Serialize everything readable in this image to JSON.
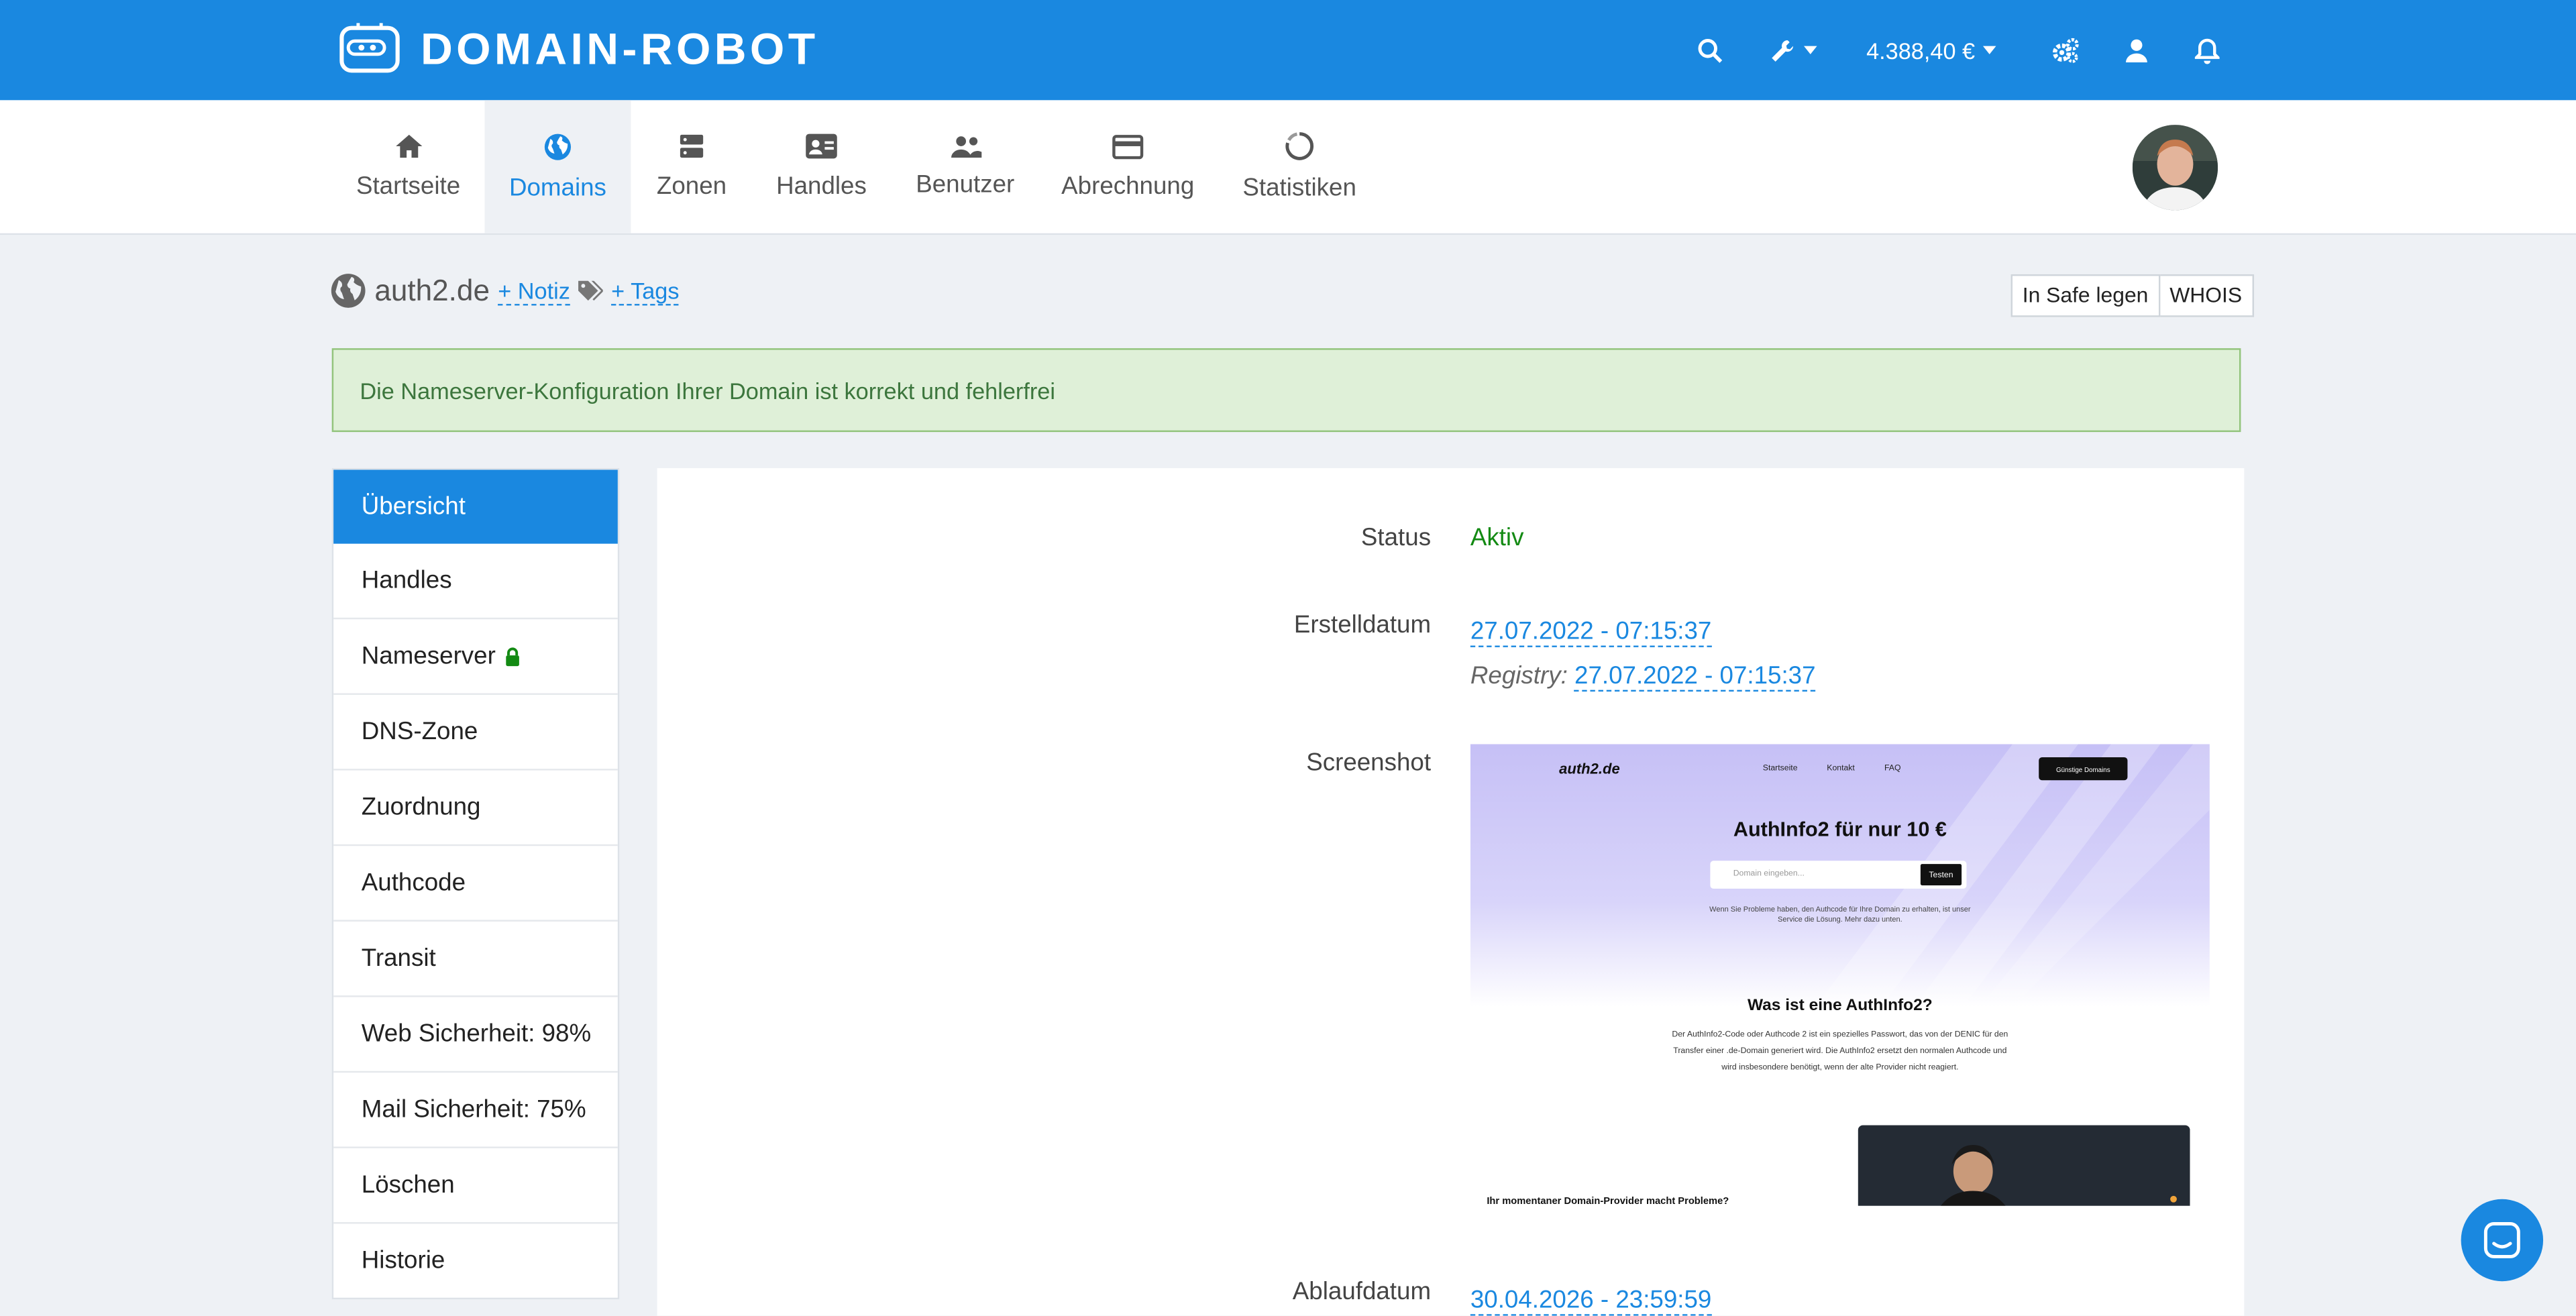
{
  "brand": {
    "name": "DOMAIN-ROBOT"
  },
  "topbar": {
    "balance": "4.388,40 €"
  },
  "nav": [
    {
      "label": "Startseite"
    },
    {
      "label": "Domains"
    },
    {
      "label": "Zonen"
    },
    {
      "label": "Handles"
    },
    {
      "label": "Benutzer"
    },
    {
      "label": "Abrechnung"
    },
    {
      "label": "Statistiken"
    }
  ],
  "domain": {
    "name": "auth2.de",
    "note_link": "+ Notiz",
    "tags_link": "+ Tags",
    "safe_button": "In Safe legen",
    "whois_button": "WHOIS"
  },
  "alert": {
    "text": "Die Nameserver-Konfiguration Ihrer Domain ist korrekt und fehlerfrei"
  },
  "sidebar": [
    {
      "label": "Übersicht"
    },
    {
      "label": "Handles"
    },
    {
      "label": "Nameserver"
    },
    {
      "label": "DNS-Zone"
    },
    {
      "label": "Zuordnung"
    },
    {
      "label": "Authcode"
    },
    {
      "label": "Transit"
    },
    {
      "label": "Web Sicherheit: 98%"
    },
    {
      "label": "Mail Sicherheit: 75%"
    },
    {
      "label": "Löschen"
    },
    {
      "label": "Historie"
    }
  ],
  "details": {
    "status_label": "Status",
    "status_value": "Aktiv",
    "created_label": "Erstelldatum",
    "created_value": "27.07.2022 - 07:15:37",
    "registry_prefix": "Registry:",
    "registry_value": "27.07.2022 - 07:15:37",
    "screenshot_label": "Screenshot",
    "expiry_label": "Ablaufdatum",
    "expiry_value": "30.04.2026 - 23:59:59"
  },
  "preview": {
    "site_logo": "auth2.de",
    "nav_home": "Startseite",
    "nav_contact": "Kontakt",
    "nav_faq": "FAQ",
    "cta": "Günstige Domains",
    "headline": "AuthInfo2 für nur 10 €",
    "search_placeholder": "Domain eingeben...",
    "search_button": "Testen",
    "hero_text": "Wenn Sie Probleme haben, den Authcode für Ihre Domain zu erhalten, ist unser Service die Lösung. Mehr dazu unten.",
    "section_title": "Was ist eine AuthInfo2?",
    "section_text": "Der AuthInfo2-Code oder Authcode 2 ist ein spezielles Passwort, das von der DENIC für den Transfer einer .de-Domain generiert wird. Die AuthInfo2 ersetzt den normalen Authcode und wird insbesondere benötigt, wenn der alte Provider nicht reagiert.",
    "bottom_text": "Ihr momentaner Domain-Provider macht Probleme?"
  },
  "colors": {
    "primary": "#1a88e0",
    "success": "#138a13",
    "alert_bg": "#dff0d8"
  }
}
